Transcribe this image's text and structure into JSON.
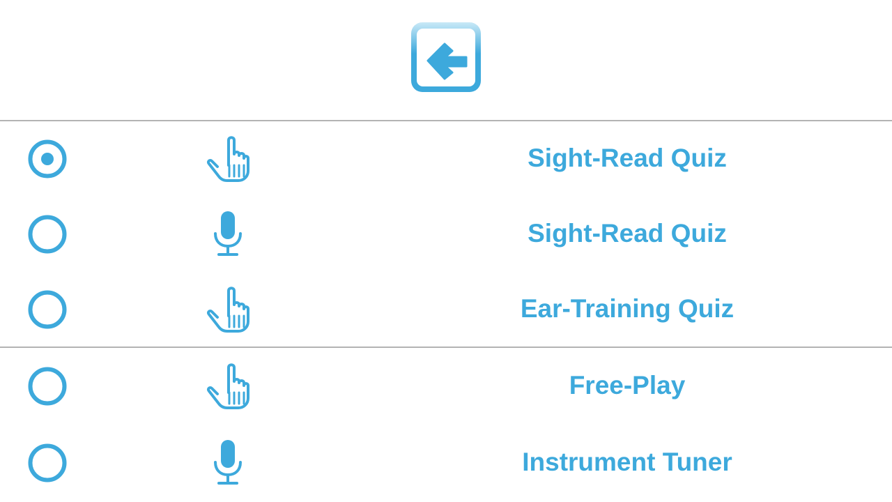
{
  "colors": {
    "accent": "#3da9dc",
    "accent_light": "#c9e9f7",
    "divider": "#b3b3b3",
    "background": "#ffffff"
  },
  "header": {
    "back_icon": "arrow-left-square-icon"
  },
  "modes": [
    {
      "label": "Sight-Read Quiz",
      "input_icon": "hand-pointer-icon",
      "selected": true
    },
    {
      "label": "Sight-Read Quiz",
      "input_icon": "microphone-icon",
      "selected": false
    },
    {
      "label": "Ear-Training Quiz",
      "input_icon": "hand-pointer-icon",
      "selected": false
    },
    {
      "label": "Free-Play",
      "input_icon": "hand-pointer-icon",
      "selected": false
    },
    {
      "label": "Instrument Tuner",
      "input_icon": "microphone-icon",
      "selected": false
    }
  ]
}
